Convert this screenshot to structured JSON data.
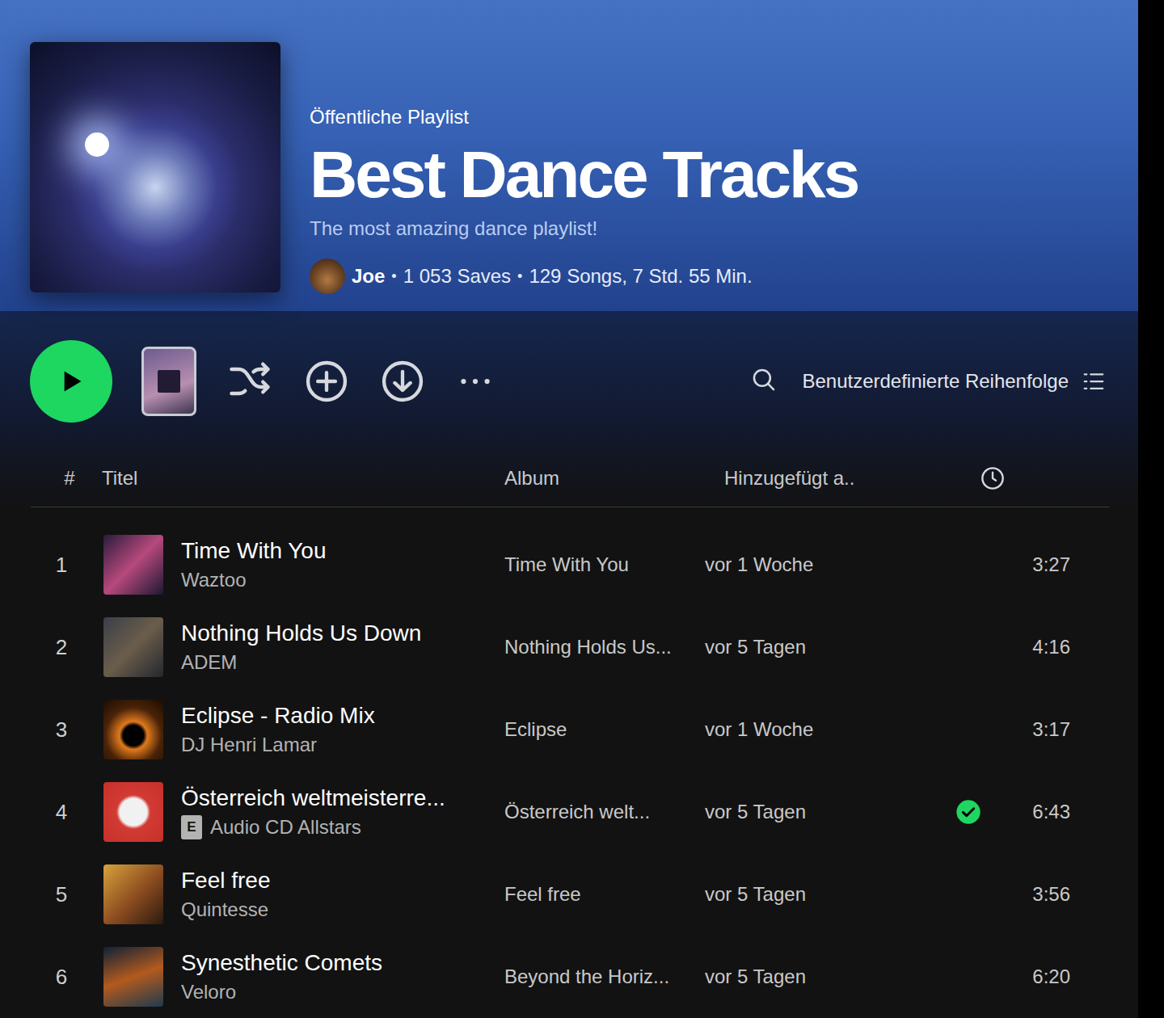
{
  "playlist": {
    "type": "Öffentliche Playlist",
    "title": "Best Dance Tracks",
    "description": "The most amazing dance playlist!",
    "owner": "Joe",
    "separator": "•",
    "saves": "1 053 Saves",
    "length": "129 Songs, 7 Std. 55 Min."
  },
  "controls": {
    "sort": "Benutzerdefinierte Reihenfolge"
  },
  "table": {
    "columns": [
      "#",
      "Titel",
      "Album",
      "Hinzugefügt a.."
    ],
    "explicit_label": "E",
    "rows": [
      {
        "index": "1",
        "title": "Time With You",
        "artist": "Waztoo",
        "explicit": false,
        "album": "Time With You",
        "added": "vor 1 Woche",
        "saved": false,
        "duration": "3:27"
      },
      {
        "index": "2",
        "title": "Nothing Holds Us Down",
        "artist": "ADEM",
        "explicit": false,
        "album": "Nothing Holds Us...",
        "added": "vor 5 Tagen",
        "saved": false,
        "duration": "4:16"
      },
      {
        "index": "3",
        "title": "Eclipse - Radio Mix",
        "artist": "DJ Henri Lamar",
        "explicit": false,
        "album": "Eclipse",
        "added": "vor 1 Woche",
        "saved": false,
        "duration": "3:17"
      },
      {
        "index": "4",
        "title": "Österreich weltmeisterre...",
        "artist": "Audio CD Allstars",
        "explicit": true,
        "album": "Österreich welt...",
        "added": "vor 5 Tagen",
        "saved": true,
        "duration": "6:43"
      },
      {
        "index": "5",
        "title": "Feel free",
        "artist": "Quintesse",
        "explicit": false,
        "album": "Feel free",
        "added": "vor 5 Tagen",
        "saved": false,
        "duration": "3:56"
      },
      {
        "index": "6",
        "title": "Synesthetic Comets",
        "artist": "Veloro",
        "explicit": false,
        "album": "Beyond the Horiz...",
        "added": "vor 5 Tagen",
        "saved": false,
        "duration": "6:20"
      }
    ]
  }
}
